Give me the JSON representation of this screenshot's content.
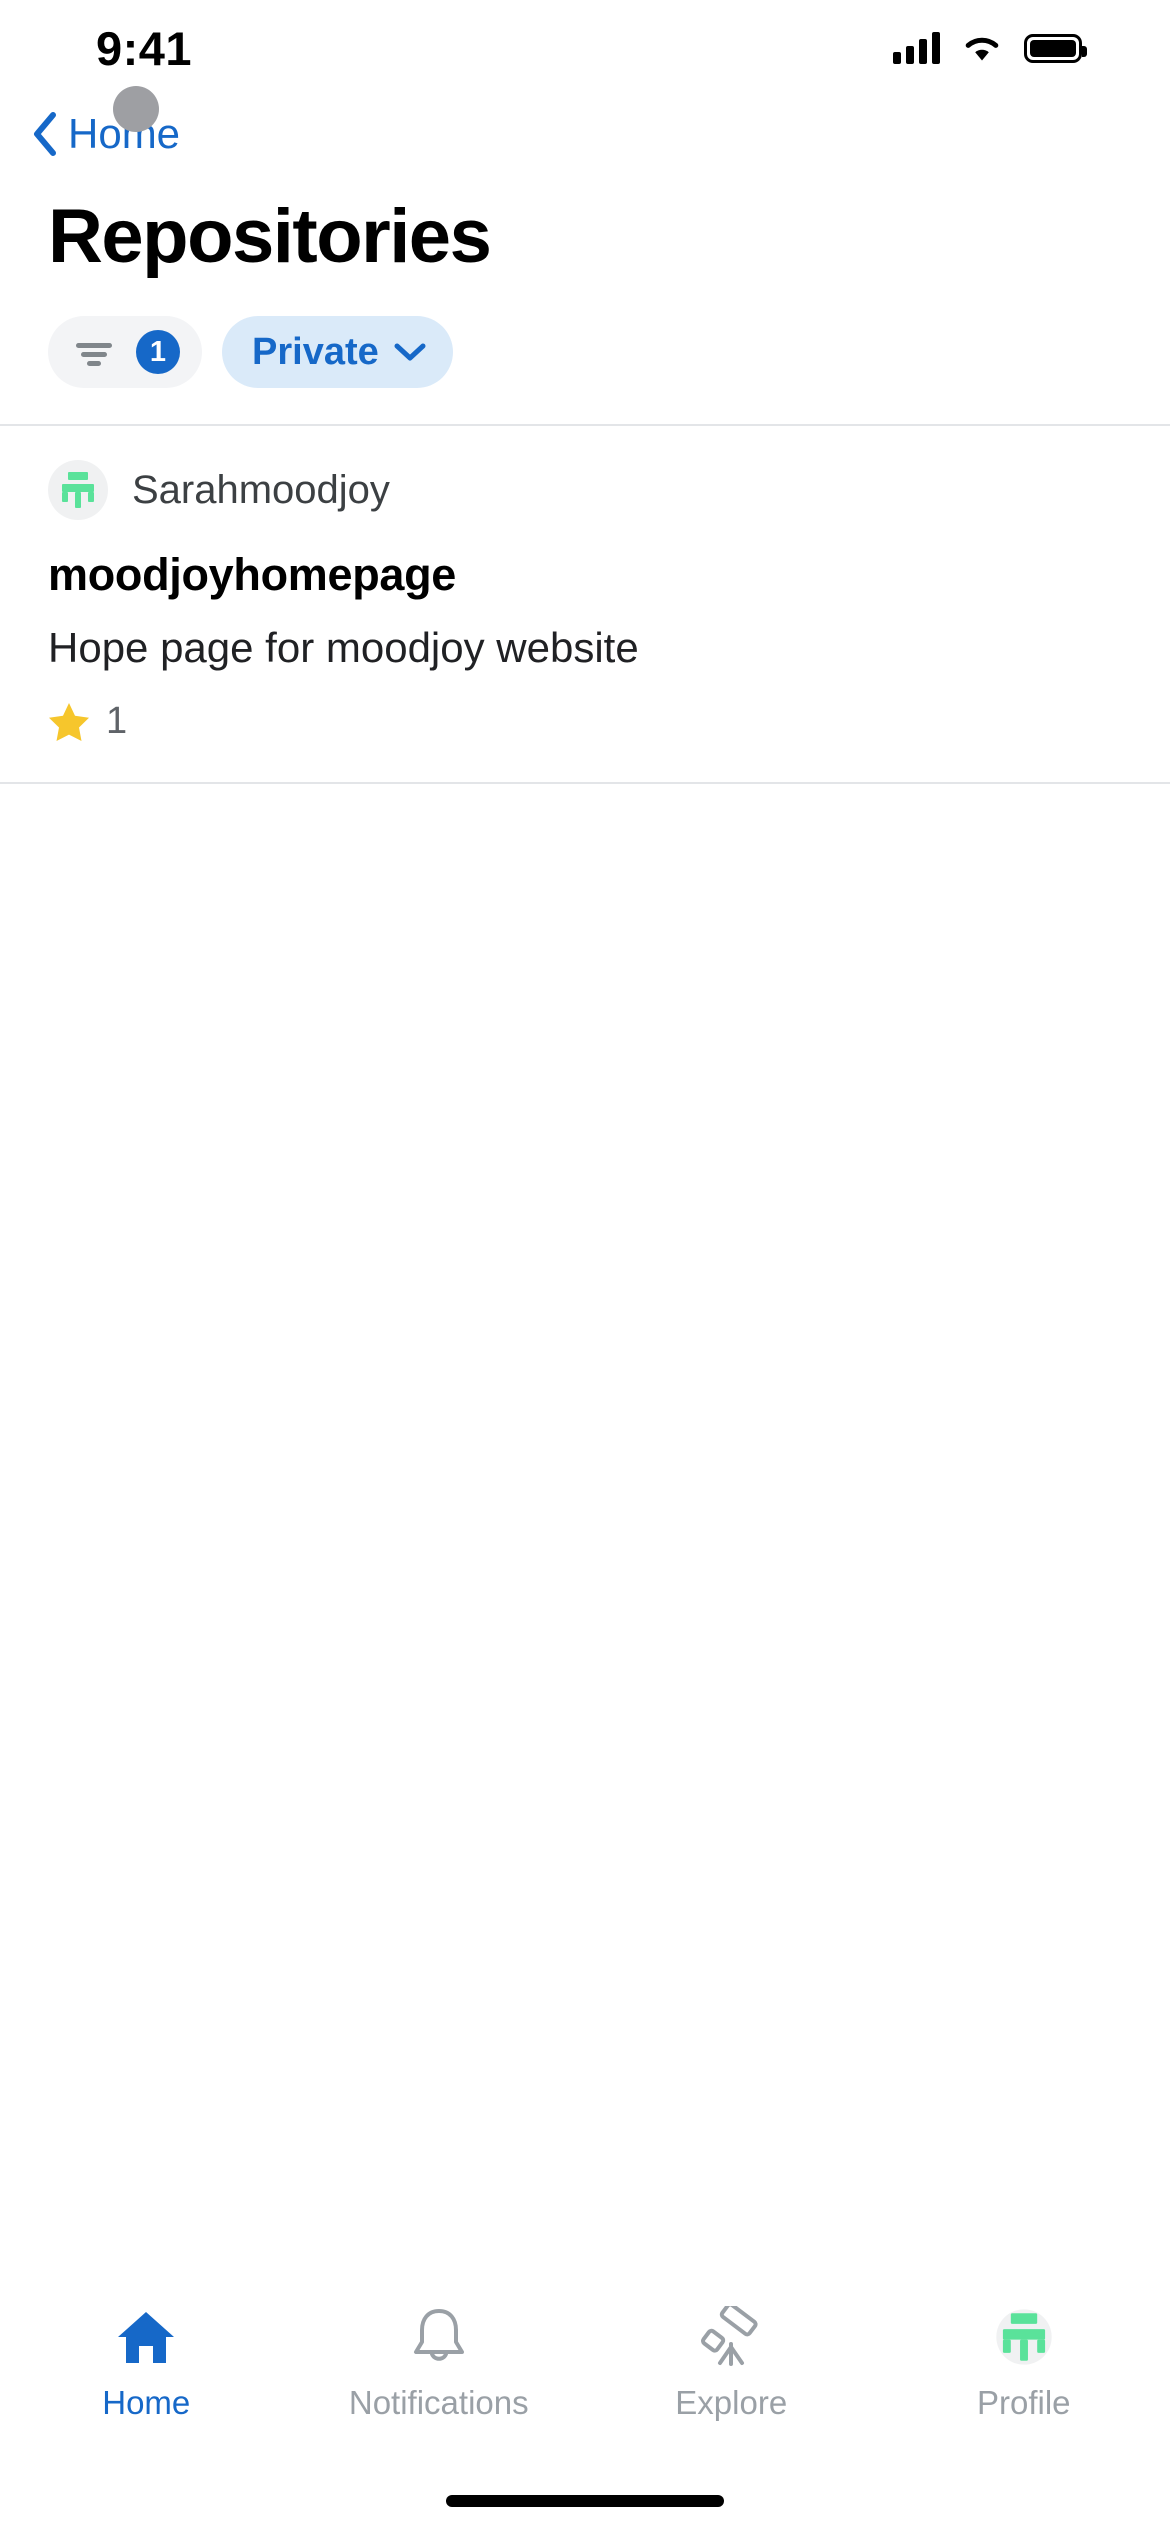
{
  "status_bar": {
    "time": "9:41",
    "cellular_icon": "cellular-signal-icon",
    "wifi_icon": "wifi-icon",
    "battery_icon": "battery-full-icon"
  },
  "navbar": {
    "back_icon": "chevron-left-icon",
    "back_label": "Home"
  },
  "header": {
    "title": "Repositories"
  },
  "filters": {
    "filter_chip": {
      "icon": "filter-lines-icon",
      "badge_count": "1"
    },
    "private_chip": {
      "label": "Private",
      "icon": "chevron-down-icon"
    }
  },
  "repositories": [
    {
      "owner": "Sarahmoodjoy",
      "owner_avatar_icon": "moodjoy-logo-icon",
      "name": "moodjoyhomepage",
      "description": "Hope page for moodjoy website",
      "star_icon": "star-icon",
      "star_count": "1"
    }
  ],
  "tabbar": {
    "items": [
      {
        "label": "Home",
        "icon": "home-icon",
        "active": true
      },
      {
        "label": "Notifications",
        "icon": "bell-icon",
        "active": false
      },
      {
        "label": "Explore",
        "icon": "telescope-icon",
        "active": false
      },
      {
        "label": "Profile",
        "icon": "moodjoy-logo-icon",
        "active": false
      }
    ]
  },
  "colors": {
    "accent_blue": "#1668c8",
    "chip_private_bg": "#daeaf9",
    "chip_filter_bg": "#f3f4f6",
    "brand_green": "#5ae29a",
    "star_yellow": "#f6c62c",
    "inactive_gray": "#9aa0a6"
  },
  "cursor": {
    "type": "touch-pointer"
  }
}
